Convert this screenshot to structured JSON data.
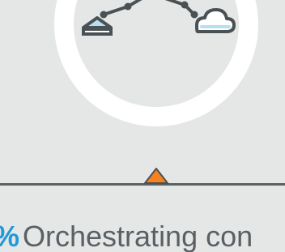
{
  "caption": {
    "percent_symbol": "%",
    "text": "Orchestrating con"
  },
  "colors": {
    "background": "#e5e6e6",
    "ring": "#ffffff",
    "ring_inner": "#e5e6e6",
    "icon_stroke": "#4a5154",
    "icon_fill_light": "#b7dff0",
    "marker": "#f58220",
    "timeline": "#5a6063",
    "percent": "#1f9ad7",
    "caption_text": "#5a6063"
  },
  "icons": {
    "left": "house-icon",
    "center": "network-nodes-icon",
    "right": "cloud-icon",
    "marker": "triangle-marker-icon"
  }
}
